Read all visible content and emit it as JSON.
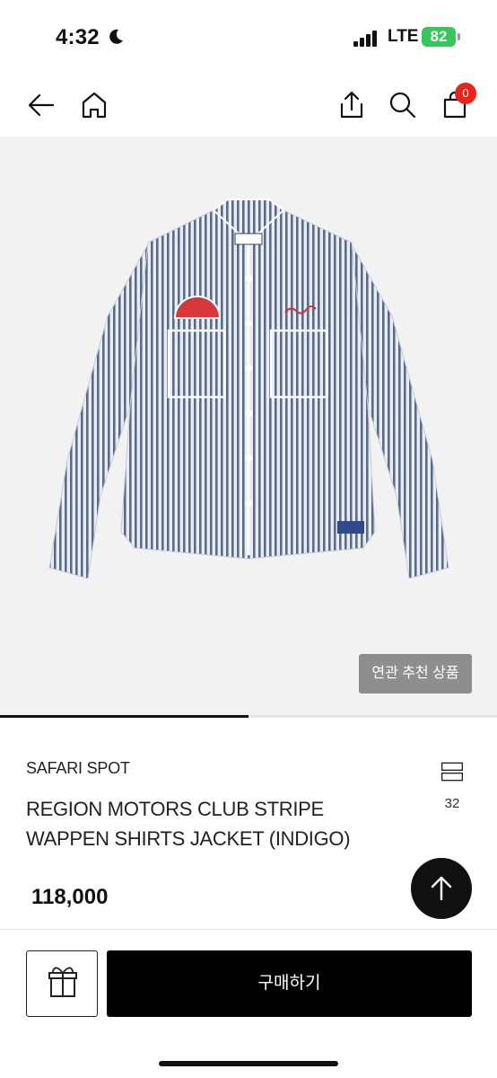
{
  "status_bar": {
    "time": "4:32",
    "network": "LTE",
    "battery": "82"
  },
  "nav": {
    "cart_count": "0"
  },
  "product": {
    "related_label": "연관 추천 상품",
    "brand": "SAFARI SPOT",
    "title": "REGION MOTORS CLUB STRIPE WAPPEN SHIRTS JACKET (INDIGO)",
    "price": "118,000",
    "wish_count": "32",
    "image_progress": 0.5
  },
  "actions": {
    "buy_label": "구매하기"
  },
  "colors": {
    "accent_badge": "#e8241c",
    "primary_button": "#000000",
    "battery": "#35c759"
  },
  "icons": [
    "moon-icon",
    "signal-icon",
    "back-arrow-icon",
    "home-icon",
    "share-icon",
    "search-icon",
    "cart-icon",
    "wishlist-icon",
    "arrow-up-icon",
    "gift-icon"
  ]
}
